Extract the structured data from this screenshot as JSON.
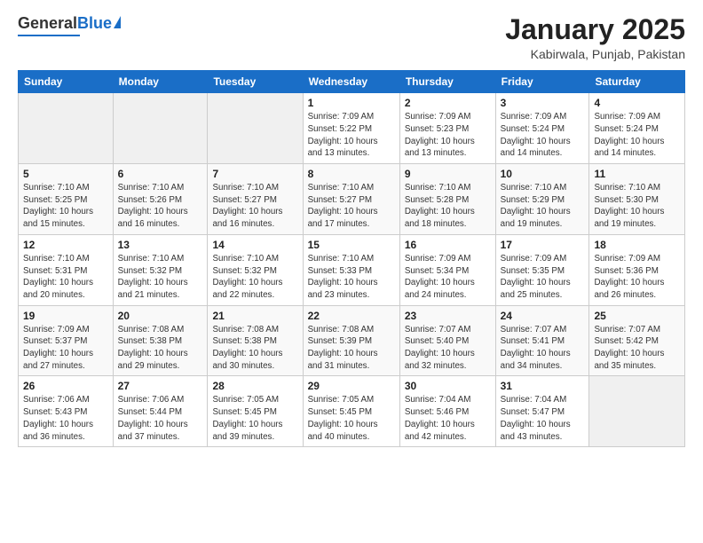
{
  "header": {
    "logo_general": "General",
    "logo_blue": "Blue",
    "month_title": "January 2025",
    "location": "Kabirwala, Punjab, Pakistan"
  },
  "days_of_week": [
    "Sunday",
    "Monday",
    "Tuesday",
    "Wednesday",
    "Thursday",
    "Friday",
    "Saturday"
  ],
  "weeks": [
    [
      {
        "day": "",
        "info": ""
      },
      {
        "day": "",
        "info": ""
      },
      {
        "day": "",
        "info": ""
      },
      {
        "day": "1",
        "info": "Sunrise: 7:09 AM\nSunset: 5:22 PM\nDaylight: 10 hours\nand 13 minutes."
      },
      {
        "day": "2",
        "info": "Sunrise: 7:09 AM\nSunset: 5:23 PM\nDaylight: 10 hours\nand 13 minutes."
      },
      {
        "day": "3",
        "info": "Sunrise: 7:09 AM\nSunset: 5:24 PM\nDaylight: 10 hours\nand 14 minutes."
      },
      {
        "day": "4",
        "info": "Sunrise: 7:09 AM\nSunset: 5:24 PM\nDaylight: 10 hours\nand 14 minutes."
      }
    ],
    [
      {
        "day": "5",
        "info": "Sunrise: 7:10 AM\nSunset: 5:25 PM\nDaylight: 10 hours\nand 15 minutes."
      },
      {
        "day": "6",
        "info": "Sunrise: 7:10 AM\nSunset: 5:26 PM\nDaylight: 10 hours\nand 16 minutes."
      },
      {
        "day": "7",
        "info": "Sunrise: 7:10 AM\nSunset: 5:27 PM\nDaylight: 10 hours\nand 16 minutes."
      },
      {
        "day": "8",
        "info": "Sunrise: 7:10 AM\nSunset: 5:27 PM\nDaylight: 10 hours\nand 17 minutes."
      },
      {
        "day": "9",
        "info": "Sunrise: 7:10 AM\nSunset: 5:28 PM\nDaylight: 10 hours\nand 18 minutes."
      },
      {
        "day": "10",
        "info": "Sunrise: 7:10 AM\nSunset: 5:29 PM\nDaylight: 10 hours\nand 19 minutes."
      },
      {
        "day": "11",
        "info": "Sunrise: 7:10 AM\nSunset: 5:30 PM\nDaylight: 10 hours\nand 19 minutes."
      }
    ],
    [
      {
        "day": "12",
        "info": "Sunrise: 7:10 AM\nSunset: 5:31 PM\nDaylight: 10 hours\nand 20 minutes."
      },
      {
        "day": "13",
        "info": "Sunrise: 7:10 AM\nSunset: 5:32 PM\nDaylight: 10 hours\nand 21 minutes."
      },
      {
        "day": "14",
        "info": "Sunrise: 7:10 AM\nSunset: 5:32 PM\nDaylight: 10 hours\nand 22 minutes."
      },
      {
        "day": "15",
        "info": "Sunrise: 7:10 AM\nSunset: 5:33 PM\nDaylight: 10 hours\nand 23 minutes."
      },
      {
        "day": "16",
        "info": "Sunrise: 7:09 AM\nSunset: 5:34 PM\nDaylight: 10 hours\nand 24 minutes."
      },
      {
        "day": "17",
        "info": "Sunrise: 7:09 AM\nSunset: 5:35 PM\nDaylight: 10 hours\nand 25 minutes."
      },
      {
        "day": "18",
        "info": "Sunrise: 7:09 AM\nSunset: 5:36 PM\nDaylight: 10 hours\nand 26 minutes."
      }
    ],
    [
      {
        "day": "19",
        "info": "Sunrise: 7:09 AM\nSunset: 5:37 PM\nDaylight: 10 hours\nand 27 minutes."
      },
      {
        "day": "20",
        "info": "Sunrise: 7:08 AM\nSunset: 5:38 PM\nDaylight: 10 hours\nand 29 minutes."
      },
      {
        "day": "21",
        "info": "Sunrise: 7:08 AM\nSunset: 5:38 PM\nDaylight: 10 hours\nand 30 minutes."
      },
      {
        "day": "22",
        "info": "Sunrise: 7:08 AM\nSunset: 5:39 PM\nDaylight: 10 hours\nand 31 minutes."
      },
      {
        "day": "23",
        "info": "Sunrise: 7:07 AM\nSunset: 5:40 PM\nDaylight: 10 hours\nand 32 minutes."
      },
      {
        "day": "24",
        "info": "Sunrise: 7:07 AM\nSunset: 5:41 PM\nDaylight: 10 hours\nand 34 minutes."
      },
      {
        "day": "25",
        "info": "Sunrise: 7:07 AM\nSunset: 5:42 PM\nDaylight: 10 hours\nand 35 minutes."
      }
    ],
    [
      {
        "day": "26",
        "info": "Sunrise: 7:06 AM\nSunset: 5:43 PM\nDaylight: 10 hours\nand 36 minutes."
      },
      {
        "day": "27",
        "info": "Sunrise: 7:06 AM\nSunset: 5:44 PM\nDaylight: 10 hours\nand 37 minutes."
      },
      {
        "day": "28",
        "info": "Sunrise: 7:05 AM\nSunset: 5:45 PM\nDaylight: 10 hours\nand 39 minutes."
      },
      {
        "day": "29",
        "info": "Sunrise: 7:05 AM\nSunset: 5:45 PM\nDaylight: 10 hours\nand 40 minutes."
      },
      {
        "day": "30",
        "info": "Sunrise: 7:04 AM\nSunset: 5:46 PM\nDaylight: 10 hours\nand 42 minutes."
      },
      {
        "day": "31",
        "info": "Sunrise: 7:04 AM\nSunset: 5:47 PM\nDaylight: 10 hours\nand 43 minutes."
      },
      {
        "day": "",
        "info": ""
      }
    ]
  ]
}
